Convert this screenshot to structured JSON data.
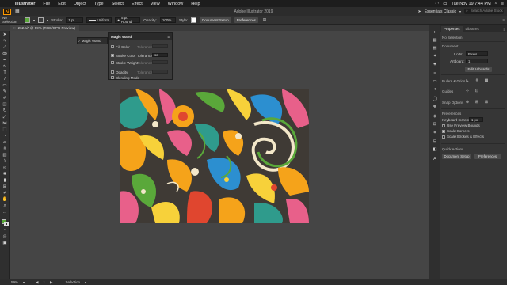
{
  "menubar": {
    "app": "Illustrator",
    "items": [
      "File",
      "Edit",
      "Object",
      "Type",
      "Select",
      "Effect",
      "View",
      "Window",
      "Help"
    ],
    "clock": "Tue Nov 19  7:44 PM"
  },
  "appbar": {
    "logo": "Ai",
    "doc_title": "Adobe Illustrator 2019",
    "workspace": "Essentials Classic",
    "search_placeholder": "Search Adobe Stock"
  },
  "control": {
    "selection_label": "No Selection",
    "stroke_label": "Stroke:",
    "stroke_weight": "1 pt",
    "profile_label": "Uniform",
    "brush_label": "5 pt. Round",
    "opacity_label": "Opacity:",
    "opacity_value": "100%",
    "style_label": "Style:",
    "doc_setup": "Document Setup",
    "preferences": "Preferences",
    "fill_color": "#5aa83a",
    "stroke_color": "#3a3a3a"
  },
  "doc_tab": {
    "label": "262.ai* @ 59% (RGB/GPU Preview)"
  },
  "magic_wand": {
    "tab_label": "Magic Wand",
    "title": "Magic Wand",
    "rows": [
      {
        "label": "Fill Color",
        "checked": false,
        "right": "Tolerance:"
      },
      {
        "label": "Stroke Color",
        "checked": true,
        "right": "Tolerance:",
        "value": "32"
      },
      {
        "label": "Stroke Weight",
        "checked": false,
        "right": "Tolerance:"
      },
      {
        "label": "Opacity",
        "checked": false,
        "right": "Tolerance:"
      },
      {
        "label": "Blending Mode",
        "checked": false,
        "right": ""
      }
    ]
  },
  "properties": {
    "tabs": [
      "Properties",
      "Libraries"
    ],
    "no_selection": "No Selection",
    "document_head": "Document",
    "units_label": "Units:",
    "units_value": "Pixels",
    "artboard_label": "Artboard:",
    "artboard_value": "1",
    "edit_artboards": "Edit Artboards",
    "rulers_grids": "Rulers & Grids",
    "guides": "Guides",
    "snap_options": "Snap Options",
    "preferences_head": "Preferences",
    "keyboard_increment_label": "Keyboard Increment:",
    "keyboard_increment_value": "1 px",
    "use_preview_bounds": "Use Preview Bounds",
    "scale_corners": "Scale Corners",
    "scale_strokes": "Scale Strokes & Effects",
    "quick_actions": "Quick Actions",
    "doc_setup": "Document Setup",
    "preferences": "Preferences"
  },
  "status": {
    "zoom": "59%",
    "page": "1",
    "tool": "Selection"
  },
  "colors": {
    "orange": "#f5a31a",
    "yellow": "#f7d13a",
    "pink": "#e8608a",
    "green": "#5aa83a",
    "teal": "#2f9b8c",
    "blue": "#2c8fd0",
    "cream": "#f3e7c9",
    "red": "#e0462f",
    "dark": "#3f3a35"
  }
}
